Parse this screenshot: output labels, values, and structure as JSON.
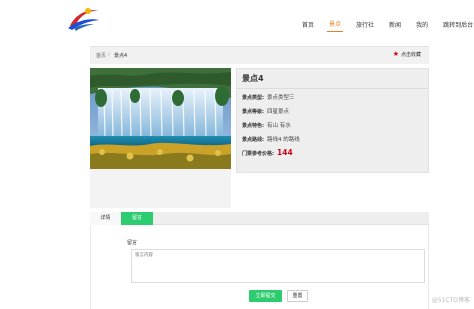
{
  "nav": {
    "items": [
      {
        "label": "首页",
        "active": false
      },
      {
        "label": "景点",
        "active": true
      },
      {
        "label": "旅行社",
        "active": false
      },
      {
        "label": "新闻",
        "active": false
      },
      {
        "label": "我的",
        "active": false
      },
      {
        "label": "跳转到后台",
        "active": false
      }
    ],
    "accent_color": "#e67e22"
  },
  "breadcrumb": {
    "home": "首页",
    "separator": "/",
    "current": "景点4"
  },
  "favorite": {
    "icon": "star-icon",
    "label": "点击收藏"
  },
  "spot": {
    "title": "景点4",
    "rows": [
      {
        "label": "景点类型:",
        "value": "景点类型三"
      },
      {
        "label": "景点等级:",
        "value": "四星景点"
      },
      {
        "label": "景点特色:",
        "value": "有山 有水"
      },
      {
        "label": "景点路线:",
        "value": "路线4 的路线"
      }
    ],
    "price_label": "门票参考价格:",
    "price_value": "144",
    "price_color": "#d0021b"
  },
  "tabs": [
    {
      "label": "详情",
      "active": false
    },
    {
      "label": "留言",
      "active": true
    }
  ],
  "comment": {
    "label": "留言",
    "placeholder": "留言内容",
    "submit_label": "立即提交",
    "reset_label": "重置"
  },
  "colors": {
    "green": "#2ecc71"
  },
  "watermark": "@51CTO博客"
}
